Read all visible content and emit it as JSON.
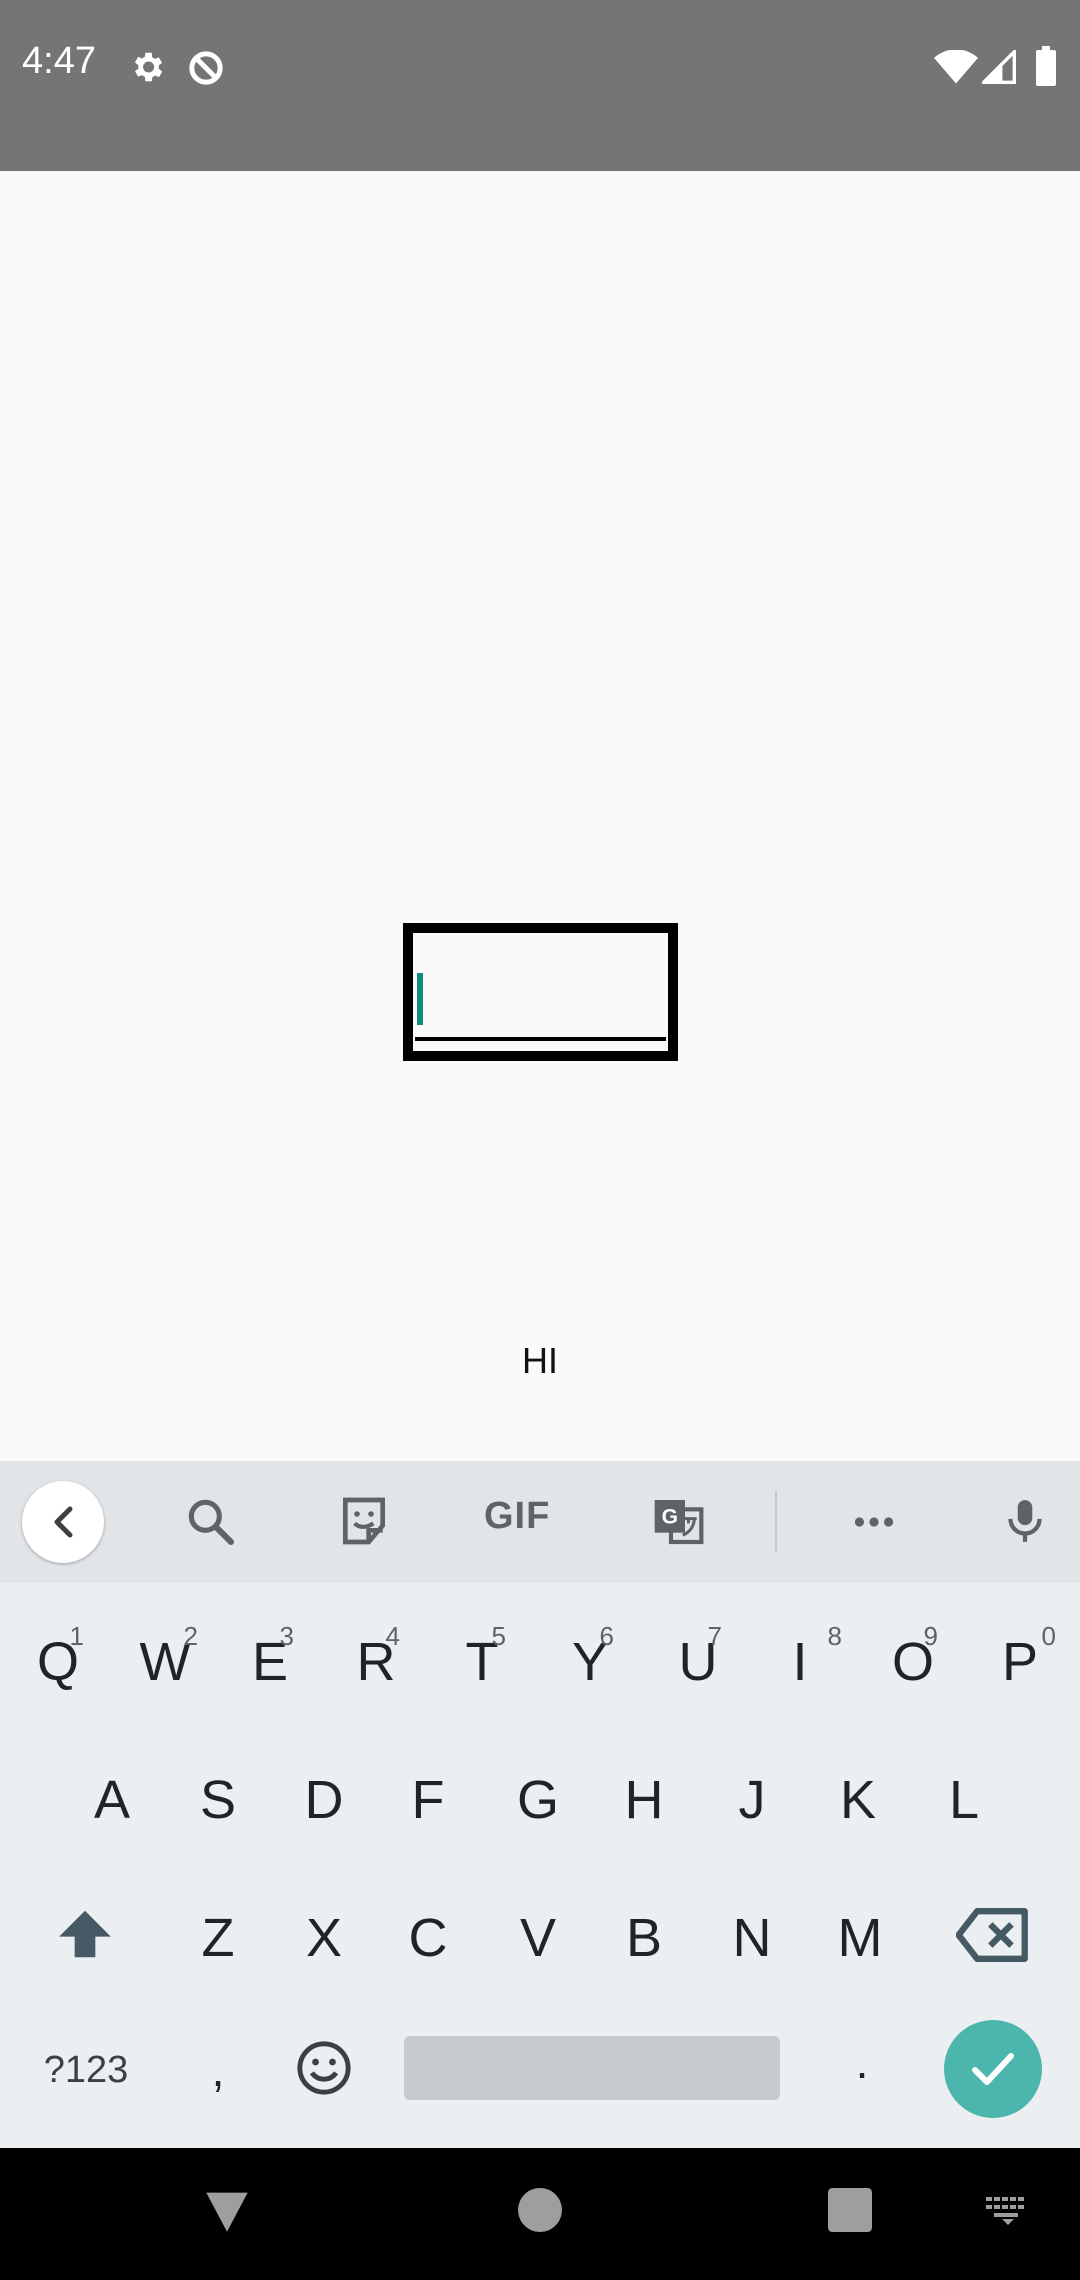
{
  "status": {
    "time": "4:47"
  },
  "main": {
    "label": "HI"
  },
  "keyboard": {
    "toolbar": {
      "gif_label": "GIF"
    },
    "row1": [
      {
        "key": "Q",
        "hint": "1"
      },
      {
        "key": "W",
        "hint": "2"
      },
      {
        "key": "E",
        "hint": "3"
      },
      {
        "key": "R",
        "hint": "4"
      },
      {
        "key": "T",
        "hint": "5"
      },
      {
        "key": "Y",
        "hint": "6"
      },
      {
        "key": "U",
        "hint": "7"
      },
      {
        "key": "I",
        "hint": "8"
      },
      {
        "key": "O",
        "hint": "9"
      },
      {
        "key": "P",
        "hint": "0"
      }
    ],
    "row2": [
      "A",
      "S",
      "D",
      "F",
      "G",
      "H",
      "J",
      "K",
      "L"
    ],
    "row3": [
      "Z",
      "X",
      "C",
      "V",
      "B",
      "N",
      "M"
    ],
    "row4": {
      "symbols": "?123",
      "comma": ",",
      "period": "."
    }
  }
}
